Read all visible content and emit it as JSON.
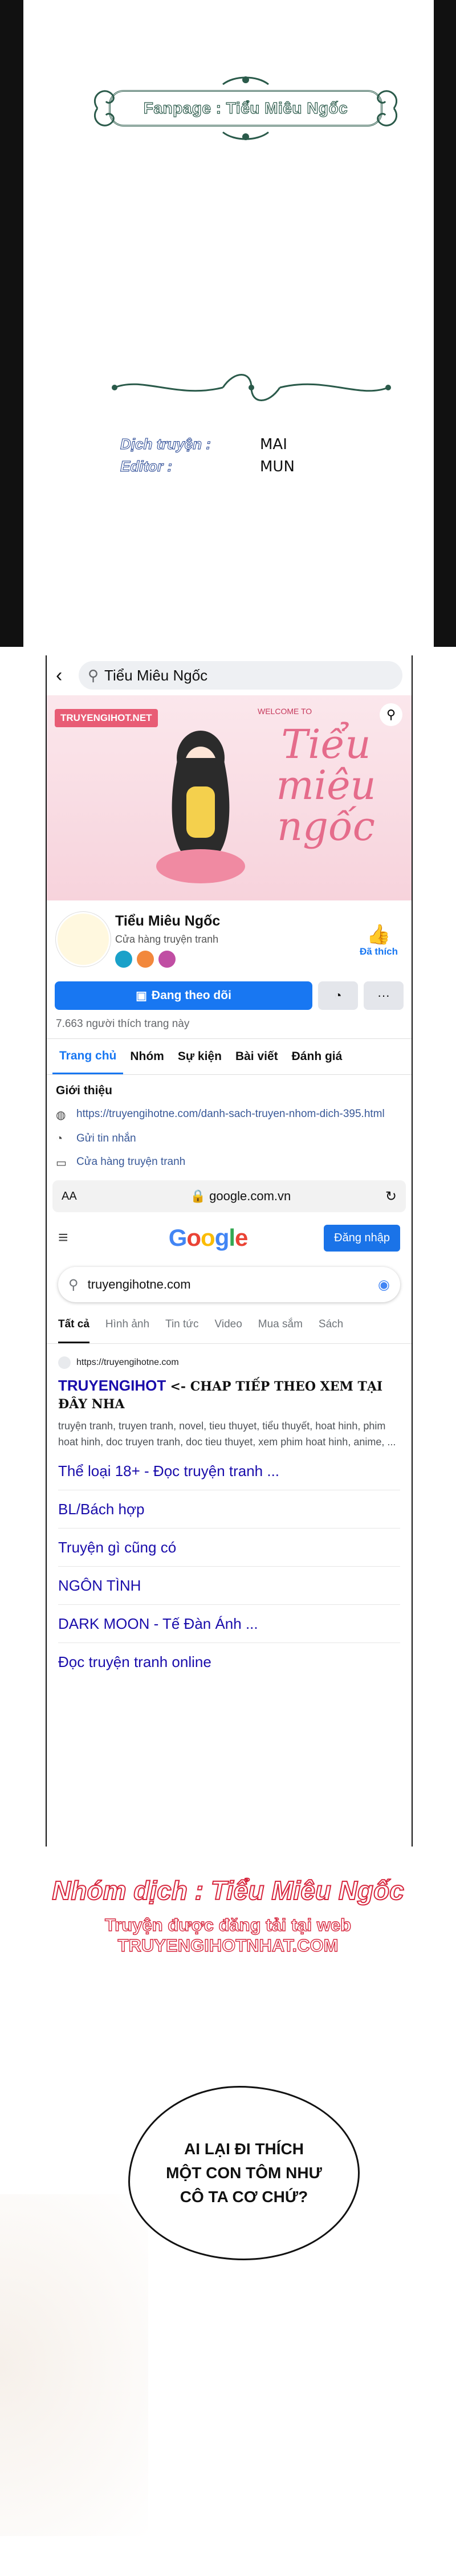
{
  "credit_page": {
    "fanpage_label": "Fanpage : Tiểu Miêu Ngốc",
    "translator_label": "Dịch truyện :",
    "translator_value": "MAI",
    "editor_label": "Editor :",
    "editor_value": "MUN"
  },
  "facebook": {
    "search_value": "Tiểu Miêu Ngốc",
    "cover_site_label": "TRUYENGIHOT.NET",
    "cover_welcome": "WELCOME TO",
    "cover_title": "Tiểu miêu ngốc",
    "page_name": "Tiểu Miêu Ngốc",
    "page_category": "Cửa hàng truyện tranh",
    "like_label": "Đã thích",
    "follow_button": "Đang theo dõi",
    "likes_count": "7.663 người thích trang này",
    "tabs": [
      "Trang chủ",
      "Nhóm",
      "Sự kiện",
      "Bài viết",
      "Đánh giá"
    ],
    "about_heading": "Giới thiệu",
    "about_rows": [
      "https://truyengihotne.com/danh-sach-truyen-nhom-dich-395.html",
      "Gửi tin nhắn",
      "Cửa hàng truyện tranh"
    ]
  },
  "browser": {
    "text_size": "AA",
    "address": "google.com.vn"
  },
  "google": {
    "logo": "Google",
    "signin_button": "Đăng nhập",
    "search_value": "truyengihotne.com",
    "tabs": [
      "Tất cả",
      "Hình ảnh",
      "Tin tức",
      "Video",
      "Mua sắm",
      "Sách"
    ],
    "result_site": "https://truyengihotne.com",
    "result_title": "TRUYENGIHOT",
    "result_title_tag": "<- CHAP TIẾP THEO XEM TẠI ĐÂY NHA",
    "result_snippet": "truyện tranh, truyen tranh, novel, tieu thuyet, tiểu thuyết, hoat hinh, phim hoat hinh, doc truyen tranh, doc tieu thuyet, xem phim hoat hinh, anime, ...",
    "sitelinks": [
      "Thể loại 18+ - Đọc truyện tranh ...",
      "BL/Bách hợp",
      "Truyện gì cũng có",
      "NGÔN TÌNH",
      "DARK MOON - Tế Đàn Ánh ...",
      "Đọc truyện tranh online"
    ]
  },
  "promo": {
    "line1": "Nhóm dịch : Tiểu Miêu Ngốc",
    "line2": "Truyện được đăng tải tại web TRUYENGIHOTNHAT.COM"
  },
  "dialogue": {
    "line1": "AI LẠI ĐI THÍCH",
    "line2": "MỘT CON TÔM NHƯ",
    "line3": "CÔ TA CƠ CHỨ?"
  },
  "colors": {
    "facebook_blue": "#1877f2",
    "google_link": "#1a0dab",
    "promo_red": "#d7263d",
    "frame_green": "#2a5a4a"
  }
}
